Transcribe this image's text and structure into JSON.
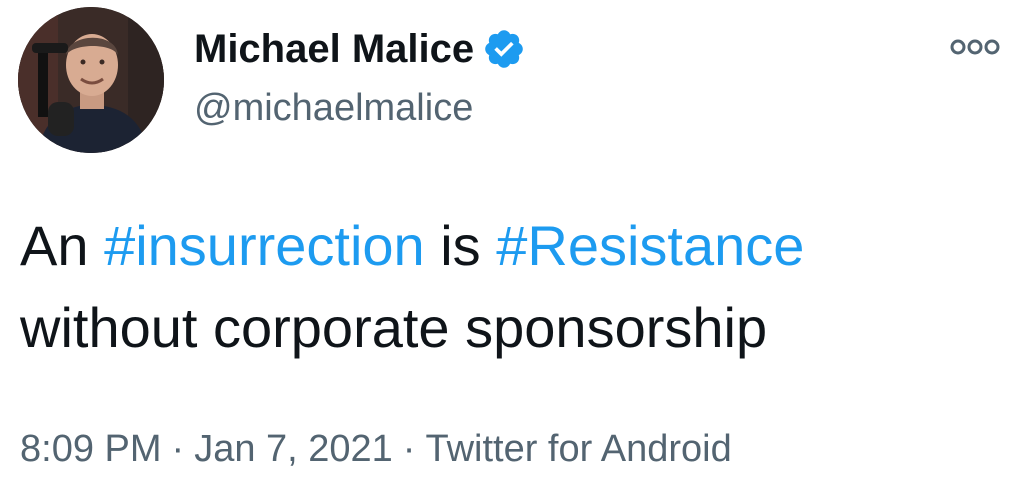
{
  "author": {
    "display_name": "Michael Malice",
    "handle": "@michaelmalice",
    "verified": true,
    "avatar_icon": "profile-photo"
  },
  "tweet": {
    "line1": {
      "w1": "An",
      "hashtag1": "#insurrection",
      "w2": "is",
      "hashtag2": "#Resistance"
    },
    "line2": "without corporate sponsorship"
  },
  "meta": {
    "time": "8:09 PM",
    "separator": "·",
    "date": "Jan 7, 2021",
    "source": "Twitter for Android"
  },
  "colors": {
    "hashtag": "#1d9bf0",
    "verified_badge": "#1d9bf0",
    "secondary_text": "#536471",
    "primary_text": "#0f1419"
  },
  "icons": {
    "more": "more-options-icon",
    "verified": "verified-badge-icon"
  }
}
